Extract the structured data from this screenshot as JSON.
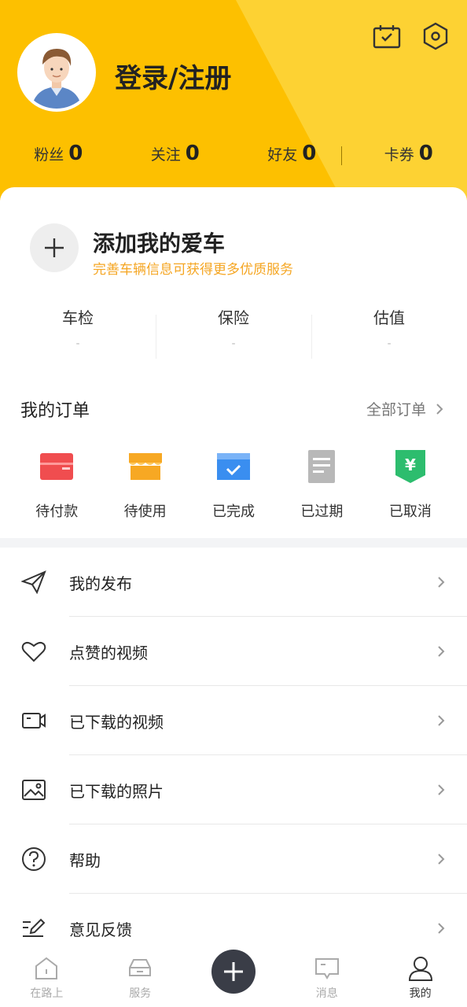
{
  "header": {
    "login_text": "登录/注册",
    "icons": {
      "calendar": "calendar-check-icon",
      "settings": "hexagon-settings-icon"
    }
  },
  "stats": [
    {
      "label": "粉丝",
      "value": "0"
    },
    {
      "label": "关注",
      "value": "0"
    },
    {
      "label": "好友",
      "value": "0"
    },
    {
      "label": "卡券",
      "value": "0"
    }
  ],
  "car": {
    "title": "添加我的爱车",
    "subtitle": "完善车辆信息可获得更多优质服务",
    "stats": [
      {
        "label": "车检",
        "value": "-"
      },
      {
        "label": "保险",
        "value": "-"
      },
      {
        "label": "估值",
        "value": "-"
      }
    ]
  },
  "orders": {
    "title": "我的订单",
    "all_label": "全部订单",
    "items": [
      {
        "label": "待付款",
        "icon": "wallet-icon",
        "color": "#f04d4f"
      },
      {
        "label": "待使用",
        "icon": "shop-icon",
        "color": "#f7a823"
      },
      {
        "label": "已完成",
        "icon": "box-check-icon",
        "color": "#3a8ef0"
      },
      {
        "label": "已过期",
        "icon": "document-icon",
        "color": "#b8b8b8"
      },
      {
        "label": "已取消",
        "icon": "yen-shield-icon",
        "color": "#2dbd6e"
      }
    ]
  },
  "menu": [
    {
      "label": "我的发布",
      "icon": "paper-plane-icon"
    },
    {
      "label": "点赞的视频",
      "icon": "heart-icon"
    },
    {
      "label": "已下载的视频",
      "icon": "video-camera-icon"
    },
    {
      "label": "已下载的照片",
      "icon": "image-icon"
    },
    {
      "label": "帮助",
      "icon": "help-circle-icon"
    },
    {
      "label": "意见反馈",
      "icon": "pencil-feedback-icon"
    }
  ],
  "tabbar": [
    {
      "label": "在路上",
      "icon": "home-icon"
    },
    {
      "label": "服务",
      "icon": "car-icon"
    },
    {
      "label": "",
      "icon": "plus-icon"
    },
    {
      "label": "消息",
      "icon": "message-icon"
    },
    {
      "label": "我的",
      "icon": "user-icon"
    }
  ],
  "colors": {
    "brand": "#fdc000",
    "accent": "#f5a623",
    "dark": "#3a3d47"
  }
}
